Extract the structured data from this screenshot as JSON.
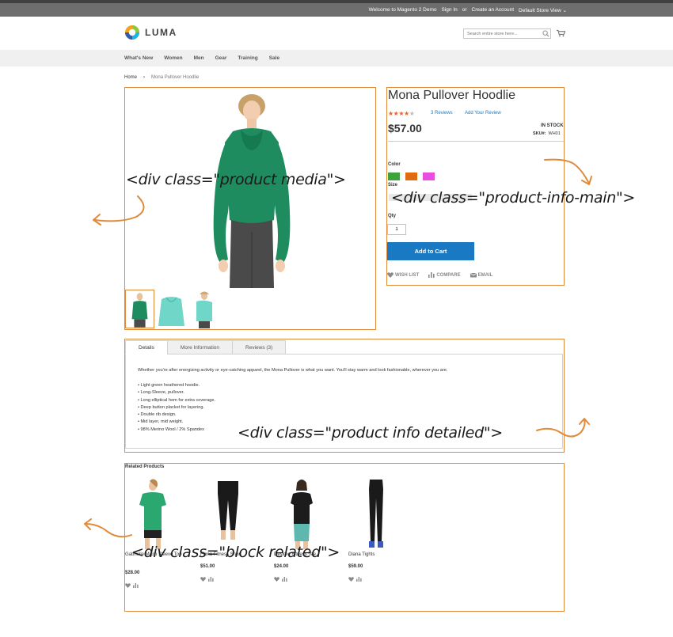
{
  "topbar": {
    "welcome": "Welcome to Magento 2 Demo",
    "sign_in": "Sign In",
    "or": "or",
    "create_account": "Create an Account",
    "store_view": "Default Store View ⌄"
  },
  "header": {
    "logo_text": "LUMA",
    "search_placeholder": "Search entire store here..."
  },
  "nav": {
    "items": [
      "What's New",
      "Women",
      "Men",
      "Gear",
      "Training",
      "Sale"
    ]
  },
  "breadcrumb": {
    "home": "Home",
    "separator": "›",
    "current": "Mona Pullover Hoodlie"
  },
  "product": {
    "title": "Mona Pullover Hoodlie",
    "rating_stars": 4,
    "rating_max": 5,
    "reviews_link": "3 Reviews",
    "add_review": "Add Your Review",
    "price": "$57.00",
    "stock": "IN STOCK",
    "sku_label": "SKU#:",
    "sku": "WH01",
    "color_label": "Color",
    "colors": [
      "#3fa33b",
      "#e06a10",
      "#e84fe0"
    ],
    "size_label": "Size",
    "qty_label": "Qty",
    "qty_value": "1",
    "add_to_cart": "Add to Cart",
    "wish_list": "WISH LIST",
    "compare": "COMPARE",
    "email": "EMAIL"
  },
  "details": {
    "tabs": [
      "Details",
      "More Information",
      "Reviews (3)"
    ],
    "description": "Whether you're after energizing activity or eye-catching apparel, the Mona Pullover is what you want. You'll stay warm and look fashionable, wherever you are.",
    "bullets": [
      "• Light green heathered hoodie.",
      "• Long-Sleeve, pullover.",
      "• Long elliptical hem for extra coverage.",
      "• Deep button placket for layering.",
      "• Double rib design.",
      "• Mid layer, mid weight.",
      "• 98% Merino Wool / 2% Spandex"
    ]
  },
  "related": {
    "title": "Related Products",
    "items": [
      {
        "name": "Gabrielle Micro Sleeve Top",
        "price": "$28.00"
      },
      {
        "name": "Fiona Fitness Short",
        "price": "$51.00"
      },
      {
        "name": "Desiree Fitness Tee",
        "price": "$24.00"
      },
      {
        "name": "Diana Tights",
        "price": "$59.00"
      }
    ]
  },
  "annotations": {
    "media": "<div class=\"product media\">",
    "info_main": "<div class=\"product-info-main\">",
    "info_detailed": "<div class=\"product info detailed\">",
    "block_related": "<div class=\"block related\">"
  },
  "colors": {
    "accent_orange": "#e08a3a",
    "button_blue": "#1979c3",
    "star_orange": "#e8632c"
  }
}
